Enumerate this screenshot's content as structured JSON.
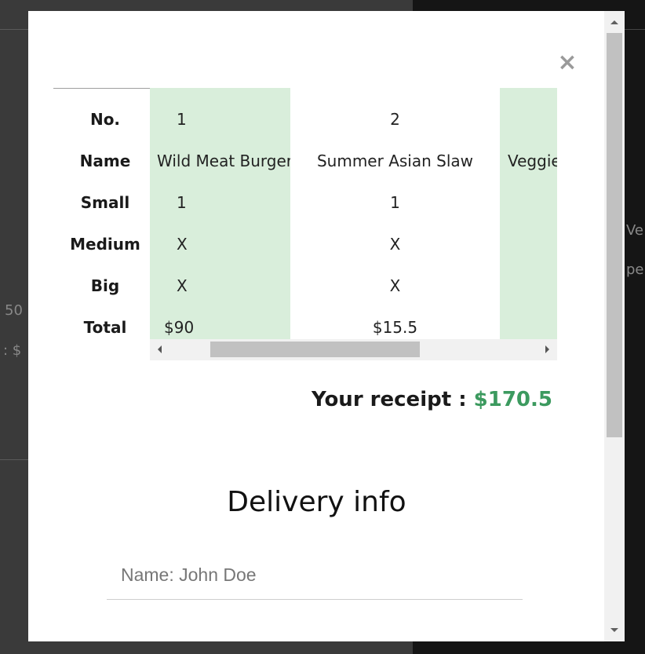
{
  "backdrop": {
    "left_fragment_1": "50",
    "left_fragment_2": ": $",
    "right_fragment_1": "Ve",
    "right_fragment_2": "pe"
  },
  "modal": {
    "close_glyph": "×",
    "row_headers": [
      "No.",
      "Name",
      "Small",
      "Medium",
      "Big",
      "Total"
    ],
    "columns": [
      {
        "no": "1",
        "name": "Wild Meat Burger",
        "small": "1",
        "medium": "X",
        "big": "X",
        "total": "$90"
      },
      {
        "no": "2",
        "name": "Summer Asian Slaw",
        "small": "1",
        "medium": "X",
        "big": "X",
        "total": "$15.5"
      },
      {
        "no": "",
        "name": "Veggie",
        "small": "",
        "medium": "",
        "big": "",
        "total": ""
      }
    ],
    "receipt_label": "Your receipt : ",
    "receipt_amount": "$170.5",
    "delivery_title": "Delivery info",
    "name_placeholder": "Name: John Doe"
  },
  "colors": {
    "accent_green": "#3c9a5f",
    "column_highlight": "#d9eedb"
  }
}
